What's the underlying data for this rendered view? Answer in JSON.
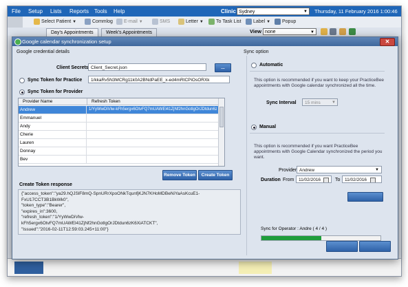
{
  "menubar": {
    "items": [
      "File",
      "Setup",
      "Lists",
      "Reports",
      "Tools",
      "Help"
    ],
    "clinic_label": "Clinic",
    "clinic_value": "Sydney",
    "datetime": "Thursday, 11 February 2016 1:00:46 pm"
  },
  "toolbar": {
    "select_patient": "Select Patient",
    "commlog": "Commlog",
    "email": "E-mail",
    "sms": "SMS",
    "letter": "Letter",
    "to_task_list": "To Task List",
    "label": "Label",
    "popup": "Popup"
  },
  "tabs": {
    "days_appointments": "Day's Appointments",
    "weeks_appointments": "Week's Appointments",
    "view_label": "View",
    "view_value": "none"
  },
  "dialog": {
    "title": "Google calendar synchronization setup",
    "left": {
      "group_title": "Google credential details",
      "client_secrets_label": "Client Secrets file",
      "client_secrets_value": "Client_Secret.json",
      "browse_label": "...",
      "sync_practice_label": "Sync Token for Practice",
      "sync_practice_value": "1/kkaRv5N3MCRg11k0A2BNdPaEE_x-ed4mRtCPiOsORXk",
      "sync_provider_label": "Sync Token for Provider",
      "grid": {
        "headers": [
          "Provider Name",
          "Refresh Token"
        ],
        "rows": [
          {
            "name": "Andrew",
            "token": "1/YyWwDiVlw-kFh5ergx6OtvFQ7mUAWEl41ZjNf2hnGotlgOrJDtdun6zK6XiATCKT"
          },
          {
            "name": "Emmanuel",
            "token": ""
          },
          {
            "name": "Andy",
            "token": ""
          },
          {
            "name": "Cherie",
            "token": ""
          },
          {
            "name": "Lauren",
            "token": ""
          },
          {
            "name": "Donnay",
            "token": ""
          },
          {
            "name": "Bev",
            "token": ""
          }
        ]
      },
      "remove_token_label": "Remove Token",
      "create_token_label": "Create Token",
      "response_title": "Create Token response",
      "response_lines": [
        "{\"access_token\":\"ya29.hQJSlF8mQ-SpnURrXpoONkTqunfjKJN7KHoMDBeNiYaAsKcuE1-",
        "FxU17CCT3B1BkWk0\",",
        "\"token_type\":\"Bearer\",",
        "\"expires_in\":3600,",
        "\"refresh_token\":\"1/YyWwDiVlw-",
        "kFh5ergx6OtvFQ7mUAWEl41ZjNf2hnGotlgOrJDtdun6zK6XiATCKT\",",
        "\"Issued\":\"2016-02-11T12:59:03.245+11:00\"}"
      ]
    },
    "right": {
      "group_title": "Sync option",
      "automatic_label": "Automatic",
      "automatic_hint": "This option is recommended if you want to keep your PracticeBee appointments with Google calendar synchronized all the time.",
      "sync_interval_label": "Sync Interval",
      "sync_interval_value": "15 mins",
      "manual_label": "Manual",
      "manual_hint": "This option is recommended if you want PracticeBee appointments with Google Calendar synchronized the period you want.",
      "provider_label": "Provider",
      "provider_value": "Andrew",
      "duration_label": "Duration",
      "from_label": "From",
      "from_value": "11/02/2016",
      "to_label": "To",
      "to_value": "11/02/2016",
      "sync_status": "Sync for Operator : Andre ( 4 / 4 )",
      "progress_fraction": 0.5
    }
  },
  "colors": {
    "menubar": "#1f66b8",
    "accent_button": "#2f62a8",
    "selection": "#3f86d8",
    "progress": "#1f9d3c",
    "close": "#c9473f"
  },
  "icons": [
    "select-patient-icon",
    "commlog-icon",
    "email-icon",
    "sms-icon",
    "letter-icon",
    "task-list-icon",
    "label-icon",
    "popup-icon",
    "calendar-icon",
    "close-icon"
  ]
}
